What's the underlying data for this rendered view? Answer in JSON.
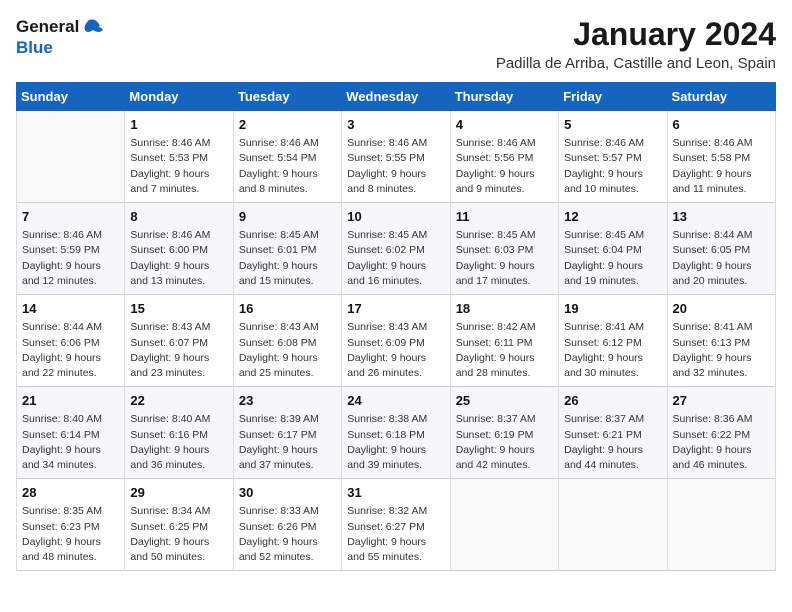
{
  "logo": {
    "line1": "General",
    "line2": "Blue"
  },
  "title": "January 2024",
  "location": "Padilla de Arriba, Castille and Leon, Spain",
  "days_of_week": [
    "Sunday",
    "Monday",
    "Tuesday",
    "Wednesday",
    "Thursday",
    "Friday",
    "Saturday"
  ],
  "weeks": [
    [
      {
        "day": "",
        "info": ""
      },
      {
        "day": "1",
        "info": "Sunrise: 8:46 AM\nSunset: 5:53 PM\nDaylight: 9 hours\nand 7 minutes."
      },
      {
        "day": "2",
        "info": "Sunrise: 8:46 AM\nSunset: 5:54 PM\nDaylight: 9 hours\nand 8 minutes."
      },
      {
        "day": "3",
        "info": "Sunrise: 8:46 AM\nSunset: 5:55 PM\nDaylight: 9 hours\nand 8 minutes."
      },
      {
        "day": "4",
        "info": "Sunrise: 8:46 AM\nSunset: 5:56 PM\nDaylight: 9 hours\nand 9 minutes."
      },
      {
        "day": "5",
        "info": "Sunrise: 8:46 AM\nSunset: 5:57 PM\nDaylight: 9 hours\nand 10 minutes."
      },
      {
        "day": "6",
        "info": "Sunrise: 8:46 AM\nSunset: 5:58 PM\nDaylight: 9 hours\nand 11 minutes."
      }
    ],
    [
      {
        "day": "7",
        "info": "Sunrise: 8:46 AM\nSunset: 5:59 PM\nDaylight: 9 hours\nand 12 minutes."
      },
      {
        "day": "8",
        "info": "Sunrise: 8:46 AM\nSunset: 6:00 PM\nDaylight: 9 hours\nand 13 minutes."
      },
      {
        "day": "9",
        "info": "Sunrise: 8:45 AM\nSunset: 6:01 PM\nDaylight: 9 hours\nand 15 minutes."
      },
      {
        "day": "10",
        "info": "Sunrise: 8:45 AM\nSunset: 6:02 PM\nDaylight: 9 hours\nand 16 minutes."
      },
      {
        "day": "11",
        "info": "Sunrise: 8:45 AM\nSunset: 6:03 PM\nDaylight: 9 hours\nand 17 minutes."
      },
      {
        "day": "12",
        "info": "Sunrise: 8:45 AM\nSunset: 6:04 PM\nDaylight: 9 hours\nand 19 minutes."
      },
      {
        "day": "13",
        "info": "Sunrise: 8:44 AM\nSunset: 6:05 PM\nDaylight: 9 hours\nand 20 minutes."
      }
    ],
    [
      {
        "day": "14",
        "info": "Sunrise: 8:44 AM\nSunset: 6:06 PM\nDaylight: 9 hours\nand 22 minutes."
      },
      {
        "day": "15",
        "info": "Sunrise: 8:43 AM\nSunset: 6:07 PM\nDaylight: 9 hours\nand 23 minutes."
      },
      {
        "day": "16",
        "info": "Sunrise: 8:43 AM\nSunset: 6:08 PM\nDaylight: 9 hours\nand 25 minutes."
      },
      {
        "day": "17",
        "info": "Sunrise: 8:43 AM\nSunset: 6:09 PM\nDaylight: 9 hours\nand 26 minutes."
      },
      {
        "day": "18",
        "info": "Sunrise: 8:42 AM\nSunset: 6:11 PM\nDaylight: 9 hours\nand 28 minutes."
      },
      {
        "day": "19",
        "info": "Sunrise: 8:41 AM\nSunset: 6:12 PM\nDaylight: 9 hours\nand 30 minutes."
      },
      {
        "day": "20",
        "info": "Sunrise: 8:41 AM\nSunset: 6:13 PM\nDaylight: 9 hours\nand 32 minutes."
      }
    ],
    [
      {
        "day": "21",
        "info": "Sunrise: 8:40 AM\nSunset: 6:14 PM\nDaylight: 9 hours\nand 34 minutes."
      },
      {
        "day": "22",
        "info": "Sunrise: 8:40 AM\nSunset: 6:16 PM\nDaylight: 9 hours\nand 36 minutes."
      },
      {
        "day": "23",
        "info": "Sunrise: 8:39 AM\nSunset: 6:17 PM\nDaylight: 9 hours\nand 37 minutes."
      },
      {
        "day": "24",
        "info": "Sunrise: 8:38 AM\nSunset: 6:18 PM\nDaylight: 9 hours\nand 39 minutes."
      },
      {
        "day": "25",
        "info": "Sunrise: 8:37 AM\nSunset: 6:19 PM\nDaylight: 9 hours\nand 42 minutes."
      },
      {
        "day": "26",
        "info": "Sunrise: 8:37 AM\nSunset: 6:21 PM\nDaylight: 9 hours\nand 44 minutes."
      },
      {
        "day": "27",
        "info": "Sunrise: 8:36 AM\nSunset: 6:22 PM\nDaylight: 9 hours\nand 46 minutes."
      }
    ],
    [
      {
        "day": "28",
        "info": "Sunrise: 8:35 AM\nSunset: 6:23 PM\nDaylight: 9 hours\nand 48 minutes."
      },
      {
        "day": "29",
        "info": "Sunrise: 8:34 AM\nSunset: 6:25 PM\nDaylight: 9 hours\nand 50 minutes."
      },
      {
        "day": "30",
        "info": "Sunrise: 8:33 AM\nSunset: 6:26 PM\nDaylight: 9 hours\nand 52 minutes."
      },
      {
        "day": "31",
        "info": "Sunrise: 8:32 AM\nSunset: 6:27 PM\nDaylight: 9 hours\nand 55 minutes."
      },
      {
        "day": "",
        "info": ""
      },
      {
        "day": "",
        "info": ""
      },
      {
        "day": "",
        "info": ""
      }
    ]
  ]
}
